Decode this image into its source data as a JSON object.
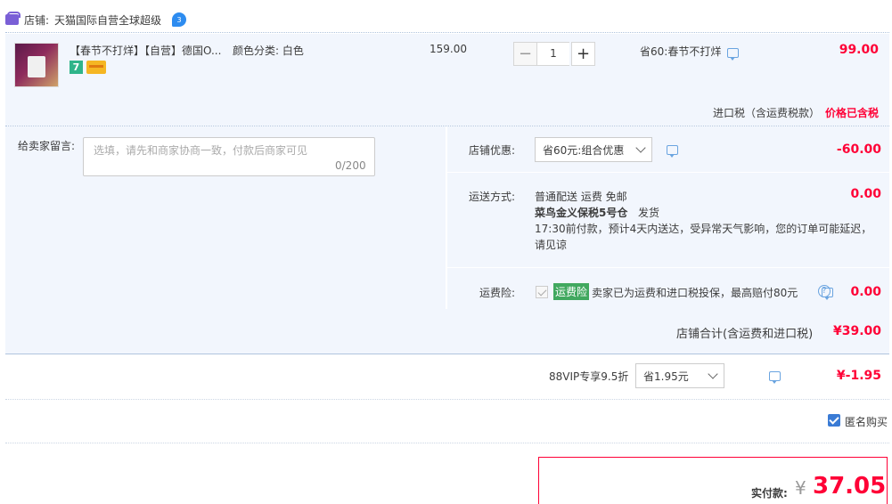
{
  "shop": {
    "label": "店铺:",
    "name": "天猫国际自营全球超级",
    "ww_icon_text": "3"
  },
  "item": {
    "title": "【春节不打烊】【自营】德国O...",
    "sku": "颜色分类: 白色",
    "unit_price": "159.00",
    "quantity": "1",
    "promo": "省60:春节不打烊",
    "total": "99.00",
    "badge_seven": "7"
  },
  "tax": {
    "label": "进口税（含运费税款）",
    "status": "价格已含税"
  },
  "message": {
    "label": "给卖家留言:",
    "placeholder": "选填，请先和商家协商一致，付款后商家可见",
    "count": "0/200"
  },
  "coupon": {
    "label": "店铺优惠:",
    "selected": "省60元:组合优惠",
    "amount": "-60.00"
  },
  "shipping": {
    "label": "运送方式:",
    "line1": "普通配送 运费 免邮",
    "warehouse": "菜鸟金义保税5号仓",
    "dispatch": "发货",
    "notice": "17:30前付款，预计4天内送达，受异常天气影响，您的订单可能延迟，请见谅",
    "amount": "0.00"
  },
  "insurance": {
    "label": "运费险:",
    "tag": "运费险",
    "text": "卖家已为运费和进口税投保，最高赔付80元",
    "help": "?",
    "amount": "0.00"
  },
  "subtotal": {
    "label": "店铺合计(含运费和进口税)",
    "amount": "¥39.00"
  },
  "vip": {
    "label": "88VIP专享9.5折",
    "selected": "省1.95元",
    "amount": "¥-1.95"
  },
  "anonymous": {
    "label": "匿名购买"
  },
  "payment": {
    "label": "实付款:",
    "currency": "¥",
    "amount": "37.05"
  },
  "colors": {
    "accent_red": "#ff0036",
    "panel_bg": "#f2f6fd",
    "link_blue": "#3a7bd5"
  }
}
